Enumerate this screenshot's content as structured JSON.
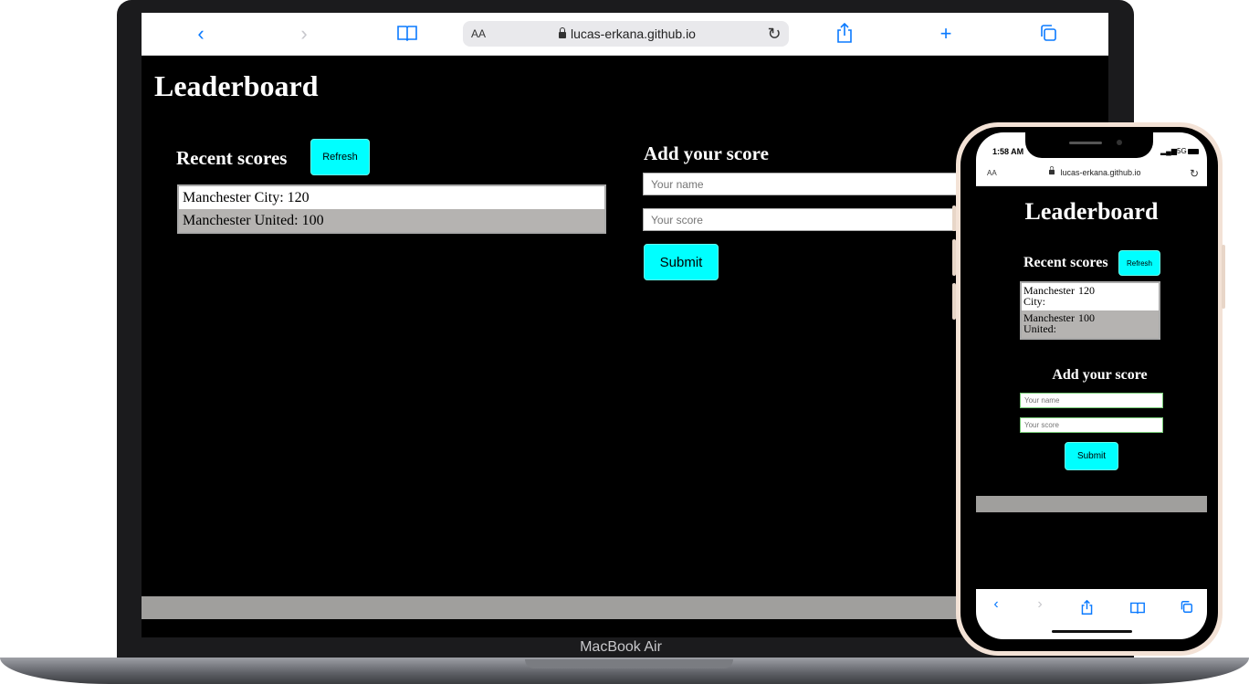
{
  "desktop": {
    "toolbar": {
      "back_icon": "‹",
      "forward_icon": "›",
      "bookmarks_icon": "book-icon",
      "address_aa": "AA",
      "url": "lucas-erkana.github.io",
      "reload_icon": "↻",
      "share_icon": "share-icon",
      "new_tab_icon": "+",
      "tabs_icon": "tabs-icon"
    },
    "page": {
      "title": "Leaderboard",
      "recent_scores_heading": "Recent scores",
      "refresh_label": "Refresh",
      "scores": [
        {
          "text": "Manchester City: 120"
        },
        {
          "text": "Manchester United: 100"
        }
      ],
      "add_score_heading": "Add your score",
      "name_placeholder": "Your name",
      "score_placeholder": "Your score",
      "submit_label": "Submit"
    },
    "brand": "MacBook Air"
  },
  "mobile": {
    "status": {
      "time": "1:58 AM",
      "network": "5G"
    },
    "address_aa": "AA",
    "url": "lucas-erkana.github.io",
    "page": {
      "title": "Leaderboard",
      "recent_scores_heading": "Recent scores",
      "refresh_label": "Refresh",
      "scores": [
        {
          "team": "Manchester City:",
          "score": "120"
        },
        {
          "team": "Manchester United:",
          "score": "100"
        }
      ],
      "add_score_heading": "Add your score",
      "name_placeholder": "Your name",
      "score_placeholder": "Your score",
      "submit_label": "Submit"
    }
  },
  "colors": {
    "accent": "#00ffff",
    "safari_blue": "#0a7aff",
    "footer": "#a09f9d",
    "alt_row": "#b5b3b1"
  }
}
